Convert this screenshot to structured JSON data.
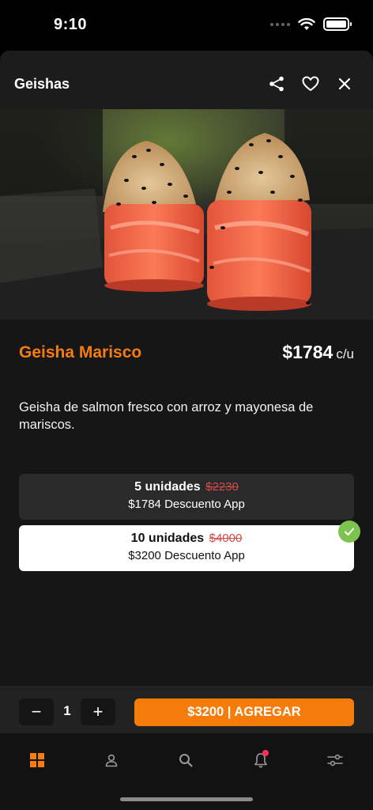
{
  "status_bar": {
    "time": "9:10",
    "icons": [
      "signal-dots-icon",
      "wifi-icon",
      "battery-icon"
    ]
  },
  "header": {
    "title": "Geishas",
    "icons": [
      "share-icon",
      "heart-icon",
      "close-icon"
    ]
  },
  "product": {
    "name": "Geisha Marisco",
    "price": "$1784",
    "price_unit": "c/u",
    "description": "Geisha de salmon fresco con arroz y mayonesa de mariscos."
  },
  "options": [
    {
      "units": "5 unidades",
      "old_price": "$2230",
      "detail": "$1784 Descuento App",
      "selected": false
    },
    {
      "units": "10 unidades",
      "old_price": "$4000",
      "detail": "$3200 Descuento App",
      "selected": true
    }
  ],
  "action_bar": {
    "minus": "−",
    "quantity": "1",
    "plus": "+",
    "add_label": "$3200 | AGREGAR"
  },
  "tab_bar": {
    "tabs": [
      "grid-icon",
      "user-icon",
      "search-icon",
      "bell-icon",
      "sliders-icon"
    ],
    "active_index": 0
  },
  "colors": {
    "accent": "#f47c12",
    "check": "#7cc44e",
    "notification": "#ff2d55",
    "strike": "#d24a4a"
  }
}
